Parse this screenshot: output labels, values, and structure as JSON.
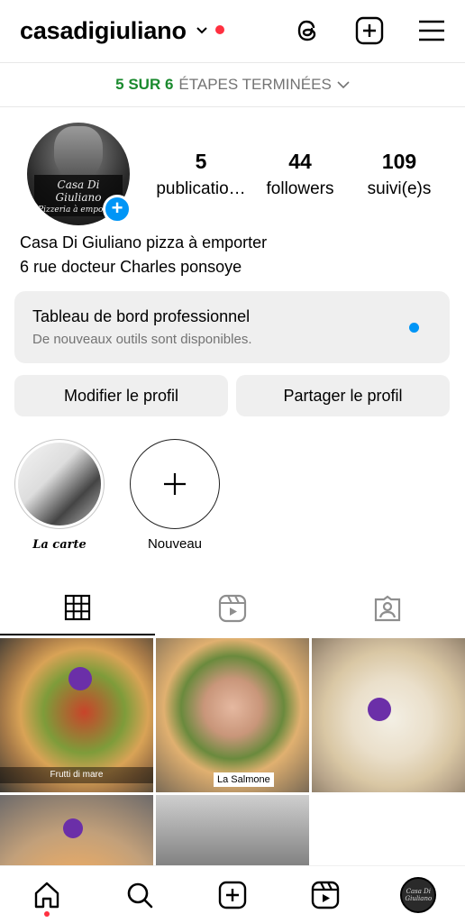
{
  "header": {
    "username": "casadigiuliano",
    "icons": [
      "chevron-down-icon",
      "threads-icon",
      "create-post-icon",
      "menu-icon"
    ],
    "notification_color": "#ff3040"
  },
  "steps": {
    "done": "5 SUR 6",
    "label": "ÉTAPES TERMINÉES"
  },
  "profile": {
    "avatar_title": "Casa Di Giuliano",
    "avatar_subtitle": "Pizzeria à emporter",
    "stats": [
      {
        "value": "5",
        "label": "publicatio…"
      },
      {
        "value": "44",
        "label": "followers"
      },
      {
        "value": "109",
        "label": "suivi(e)s"
      }
    ],
    "name": "Casa Di Giuliano pizza à emporter",
    "address": "6 rue docteur Charles ponsoye"
  },
  "dashboard": {
    "title": "Tableau de bord professionnel",
    "subtitle": "De nouveaux outils sont disponibles."
  },
  "buttons": {
    "edit": "Modifier le profil",
    "share": "Partager le profil"
  },
  "highlights": [
    {
      "label": "La carte"
    },
    {
      "label": "Nouveau"
    }
  ],
  "tabs": [
    "grid-icon",
    "reels-icon",
    "tagged-icon"
  ],
  "posts": [
    {
      "caption": "Frutti di mare"
    },
    {
      "caption": "La Salmone"
    },
    {
      "caption": ""
    },
    {
      "caption": ""
    },
    {
      "caption": ""
    }
  ],
  "bottom_nav": [
    "home-icon",
    "search-icon",
    "create-icon",
    "reels-icon",
    "profile-avatar"
  ],
  "colors": {
    "accent": "#0095f6",
    "steps_done": "#1a8a2e",
    "secondary_text": "#737373",
    "button_bg": "#efefef"
  }
}
